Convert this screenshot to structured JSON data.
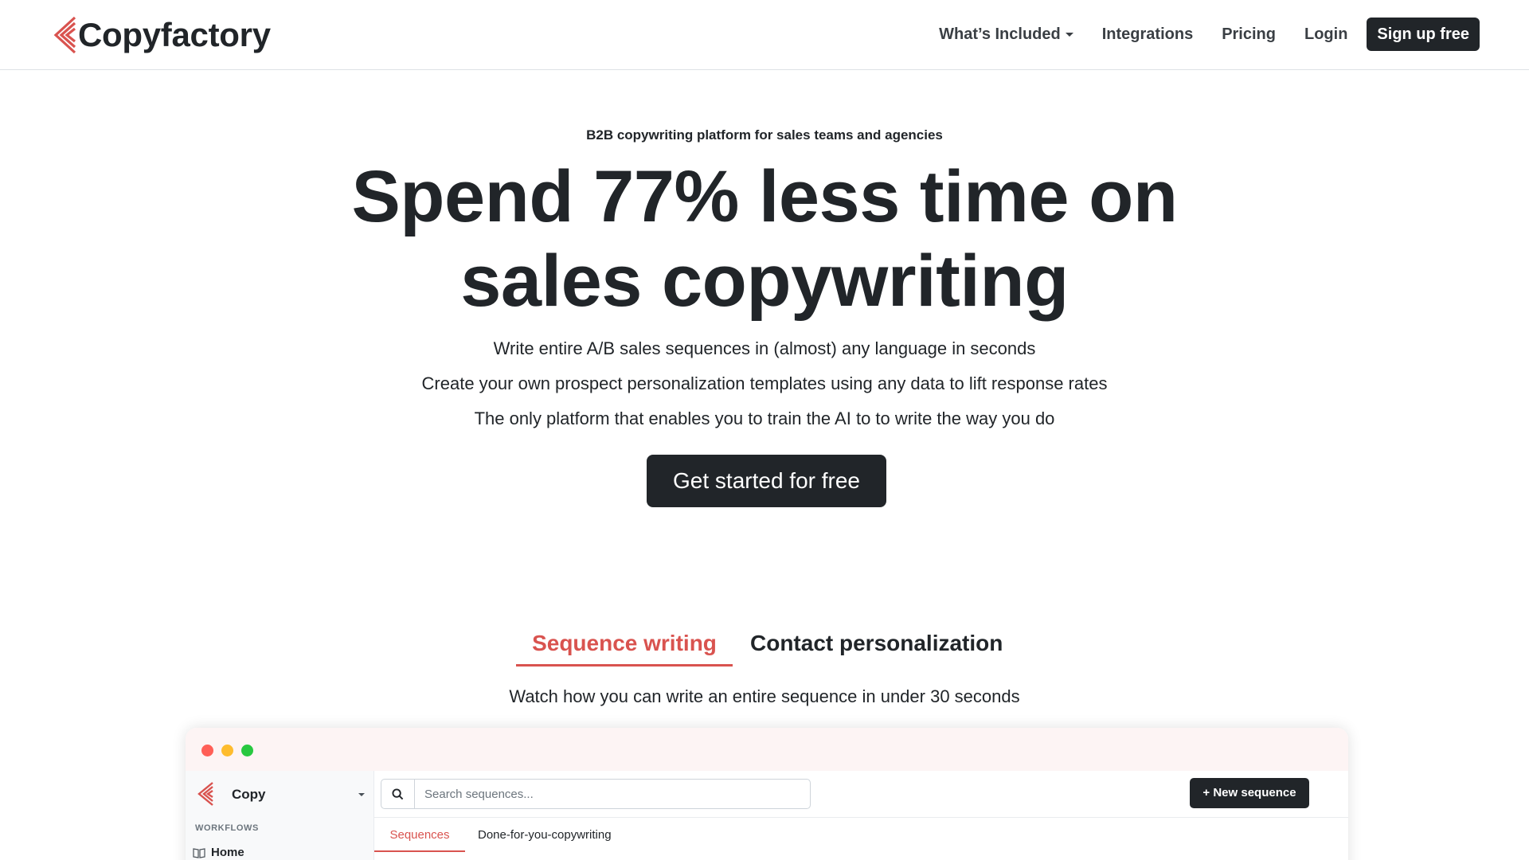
{
  "brand": {
    "name": "Copyfactory",
    "accent_color": "#d9534f",
    "dark_color": "#212529"
  },
  "nav": {
    "items": [
      {
        "label": "What’s Included",
        "has_dropdown": true
      },
      {
        "label": "Integrations"
      },
      {
        "label": "Pricing"
      },
      {
        "label": "Login"
      }
    ],
    "signup_label": "Sign up free"
  },
  "hero": {
    "eyebrow": "B2B copywriting platform for sales teams and agencies",
    "headline_line1": "Spend 77% less time on",
    "headline_line2": "sales copywriting",
    "bullets": [
      "Write entire A/B sales sequences in (almost) any language in seconds",
      "Create your own prospect personalization templates using any data to lift response rates",
      "The only platform that enables you to train the AI to to write the way you do"
    ],
    "cta_label": "Get started for free"
  },
  "feature_tabs": {
    "tabs": [
      {
        "label": "Sequence writing",
        "active": true
      },
      {
        "label": "Contact personalization",
        "active": false
      }
    ],
    "caption": "Watch how you can write an entire sequence in under 30 seconds"
  },
  "app_preview": {
    "window_dots": [
      "#ff5f57",
      "#febc2e",
      "#28c840"
    ],
    "workspace_name": "Copy",
    "sidebar_section_label": "WORKFLOWS",
    "sidebar_items": [
      {
        "label": "Home",
        "icon": "book-icon"
      }
    ],
    "search_placeholder": "Search sequences...",
    "new_sequence_label": "+ New sequence",
    "tabs": [
      {
        "label": "Sequences",
        "active": true
      },
      {
        "label": "Done-for-you-copywriting",
        "active": false
      }
    ]
  }
}
